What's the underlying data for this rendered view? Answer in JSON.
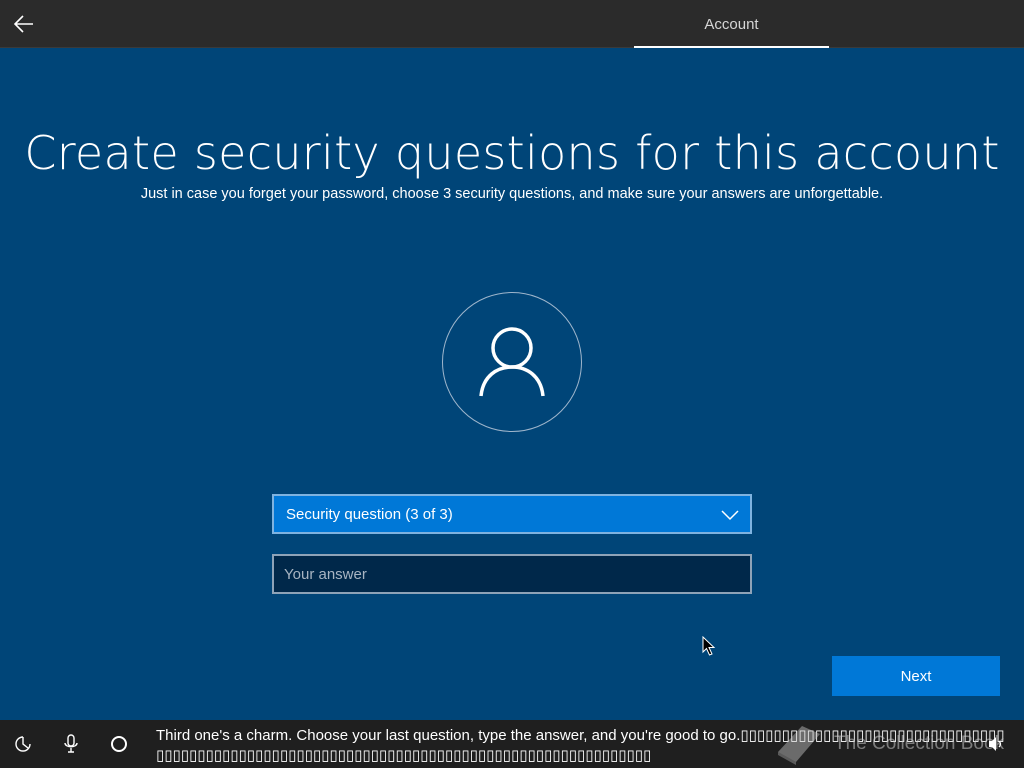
{
  "topbar": {
    "back_icon": "arrow-left-icon",
    "tab_label": "Account"
  },
  "main": {
    "title": "Create security questions for this account",
    "subtitle": "Just in case you forget your password, choose 3 security questions, and make sure your answers are unforgettable.",
    "avatar_icon": "user-icon",
    "dropdown": {
      "selected": "Security question (3 of 3)",
      "icon": "chevron-down-icon"
    },
    "answer": {
      "value": "",
      "placeholder": "Your answer"
    },
    "next_label": "Next"
  },
  "bottombar": {
    "icons": [
      "ease-of-access-icon",
      "microphone-icon",
      "cortana-circle-icon",
      "volume-icon"
    ],
    "caption": "Third one's a charm. Choose your last question, type the answer, and you're good to go.▯▯▯▯▯▯▯▯▯▯▯▯▯▯▯▯▯▯▯▯▯▯▯▯▯▯▯▯▯▯▯▯▯▯▯▯▯▯▯▯▯▯▯▯▯▯▯▯▯▯▯▯▯▯▯▯▯▯▯▯▯▯▯▯▯▯▯▯▯▯▯▯▯▯▯▯▯▯▯▯▯▯▯▯▯▯▯▯▯▯▯▯",
    "watermark": "The Collection Book"
  },
  "colors": {
    "background": "#004578",
    "accent": "#0078d7",
    "topbar": "#2b2b2b",
    "bottombar": "#1f1f1f"
  }
}
